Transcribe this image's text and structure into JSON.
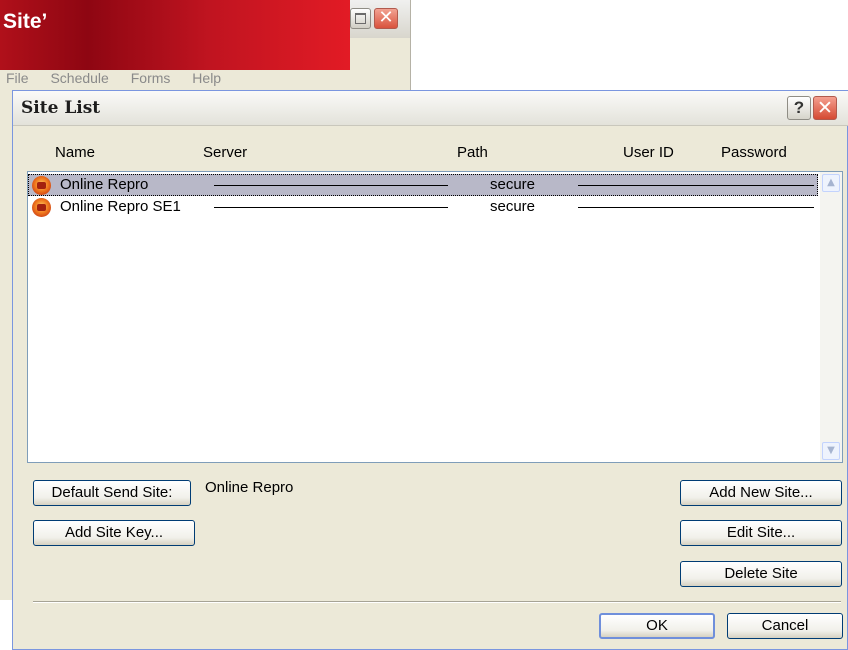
{
  "banner": {
    "title": "Site’"
  },
  "background_window": {
    "menu": [
      "File",
      "Schedule",
      "Forms",
      "Help"
    ]
  },
  "dialog": {
    "title": "Site List",
    "help_label": "?",
    "close_label": "✕",
    "columns": [
      "Name",
      "Server",
      "Path",
      "User ID",
      "Password"
    ],
    "rows": [
      {
        "name": "Online Repro",
        "path": "secure",
        "selected": true
      },
      {
        "name": "Online Repro SE1",
        "path": "secure",
        "selected": false
      }
    ],
    "scroll_up": "▲",
    "scroll_down": "▼",
    "default_send_site_button": "Default Send Site:",
    "default_send_site_value": "Online Repro",
    "add_site_key_button": "Add Site Key...",
    "add_new_site_button": "Add New Site...",
    "edit_site_button": "Edit Site...",
    "delete_site_button": "Delete Site",
    "ok_button": "OK",
    "cancel_button": "Cancel"
  },
  "colors": {
    "banner_red": "#c01420",
    "dialog_bg": "#ece9d8",
    "selection": "#b8b8c8",
    "close_red": "#d54a33"
  }
}
